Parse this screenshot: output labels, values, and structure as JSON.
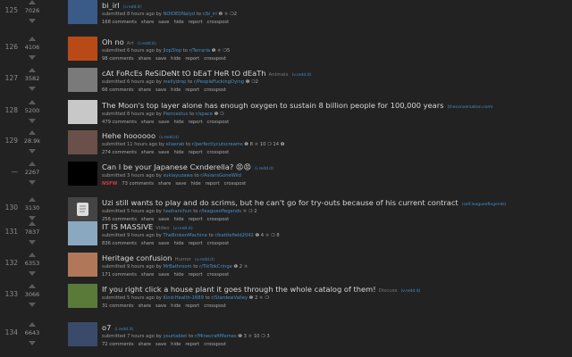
{
  "posts": [
    {
      "rank": "125",
      "score": "7026",
      "title": "bi_irl",
      "flair": "",
      "domain": "(i.redd.it)",
      "submitted": "submitted 8 hours ago by",
      "author": "NOIDEDNalyd",
      "to": "to",
      "subreddit": "r/bi_irl",
      "awards": "❷ ⚛ ❍2",
      "comments": "168 comments",
      "thumb_color": "#3a5a88",
      "nsfw": ""
    },
    {
      "rank": "126",
      "score": "4106",
      "title": "Oh no",
      "flair": "Art",
      "domain": "(i.redd.it)",
      "submitted": "submitted 6 hours ago by",
      "author": "Jlop3lop",
      "to": "to",
      "subreddit": "r/Terraria",
      "awards": "❶ ⚛ ❍5",
      "comments": "98 comments",
      "thumb_color": "#b84a18",
      "nsfw": ""
    },
    {
      "rank": "127",
      "score": "3582",
      "title": "cAt FoRcEs ReSiDeNt tO bEaT HeR tO dEaTh",
      "flair": "Animals",
      "domain": "(v.redd.it)",
      "submitted": "submitted 6 hours ago by",
      "author": "mellydrop",
      "to": "to",
      "subreddit": "r/PeopleFuckingDying",
      "awards": "❶ ❍2",
      "comments": "66 comments",
      "thumb_color": "#7a7a7a",
      "nsfw": ""
    },
    {
      "rank": "128",
      "score": "5200",
      "title": "The Moon's top layer alone has enough oxygen to sustain 8 billion people for 100,000 years",
      "flair": "",
      "domain": "(theconversation.com)",
      "submitted": "submitted 8 hours ago by",
      "author": "Plencestus",
      "to": "to",
      "subreddit": "r/space",
      "awards": "❶ ❍",
      "comments": "479 comments",
      "thumb_color": "#c8c8c8",
      "nsfw": ""
    },
    {
      "rank": "129",
      "score": "28.9k",
      "title": "Hehe hoooooo",
      "flair": "",
      "domain": "(v.redd.it)",
      "submitted": "submitted 11 hours ago by",
      "author": "eliasrab",
      "to": "to",
      "subreddit": "r/perfectlycutscreams",
      "awards": "❶ 8 ⚛ 10 ❍ 14 ❹",
      "comments": "274 comments",
      "thumb_color": "#6a5048",
      "nsfw": ""
    },
    {
      "rank": "—",
      "score": "2267",
      "title": "Can I be your Japanese Cxnderella? 😡😡",
      "flair": "",
      "domain": "(i.redd.it)",
      "submitted": "submitted 3 hours ago by",
      "author": "sukiayuzawa",
      "to": "to",
      "subreddit": "r/AsiansGoneWild",
      "awards": "",
      "comments": "73 comments",
      "thumb_color": "#000000",
      "nsfw": "NSFW"
    },
    {
      "rank": "130",
      "score": "3130",
      "title": "Uzi still wants to play and do scrims, but he can't go for try-outs because of his current contract",
      "flair": "",
      "domain": "(self.leagueoflegends)",
      "submitted": "submitted 5 hours ago by",
      "author": "haohanchun",
      "to": "to",
      "subreddit": "r/leagueoflegends",
      "awards": "⚛ ❍ 2",
      "comments": "256 comments",
      "thumb_color": "#444444",
      "nsfw": ""
    },
    {
      "rank": "131",
      "score": "7837",
      "title": "IT IS MASSIVE",
      "flair": "Video",
      "domain": "(v.redd.it)",
      "submitted": "submitted 9 hours ago by",
      "author": "TheBrokenMachine",
      "to": "to",
      "subreddit": "r/battlefield2042",
      "awards": "❶ 4 ⚛ ❍ 8",
      "comments": "836 comments",
      "thumb_color": "#8aa8c0",
      "nsfw": ""
    },
    {
      "rank": "132",
      "score": "6353",
      "title": "Heritage confusion",
      "flair": "Humor",
      "domain": "(v.redd.it)",
      "submitted": "submitted 9 hours ago by",
      "author": "MrBathroom",
      "to": "to",
      "subreddit": "r/TikTokCringe",
      "awards": "❶ 2 ⚛",
      "comments": "171 comments",
      "thumb_color": "#b07858",
      "nsfw": ""
    },
    {
      "rank": "133",
      "score": "3066",
      "title": "If you right click a house plant it goes through the whole catalog of them!",
      "flair": "Discuss",
      "domain": "(v.redd.it)",
      "submitted": "submitted 5 hours ago by",
      "author": "Kind-Health-1689",
      "to": "to",
      "subreddit": "r/StardewValley",
      "awards": "❶ 2 ⚛ ❍",
      "comments": "31 comments",
      "thumb_color": "#5a7a3a",
      "nsfw": ""
    },
    {
      "rank": "134",
      "score": "6643",
      "title": "o7",
      "flair": "",
      "domain": "(i.redd.it)",
      "submitted": "submitted 7 hours ago by",
      "author": "yourtablet",
      "to": "to",
      "subreddit": "r/MinecraftMemes",
      "awards": "❶ 3 ⚛ 10 ❍ 3",
      "comments": "72 comments",
      "thumb_color": "#3a4a6a",
      "nsfw": ""
    }
  ],
  "buttons": {
    "share": "share",
    "save": "save",
    "hide": "hide",
    "report": "report",
    "crosspost": "crosspost"
  }
}
